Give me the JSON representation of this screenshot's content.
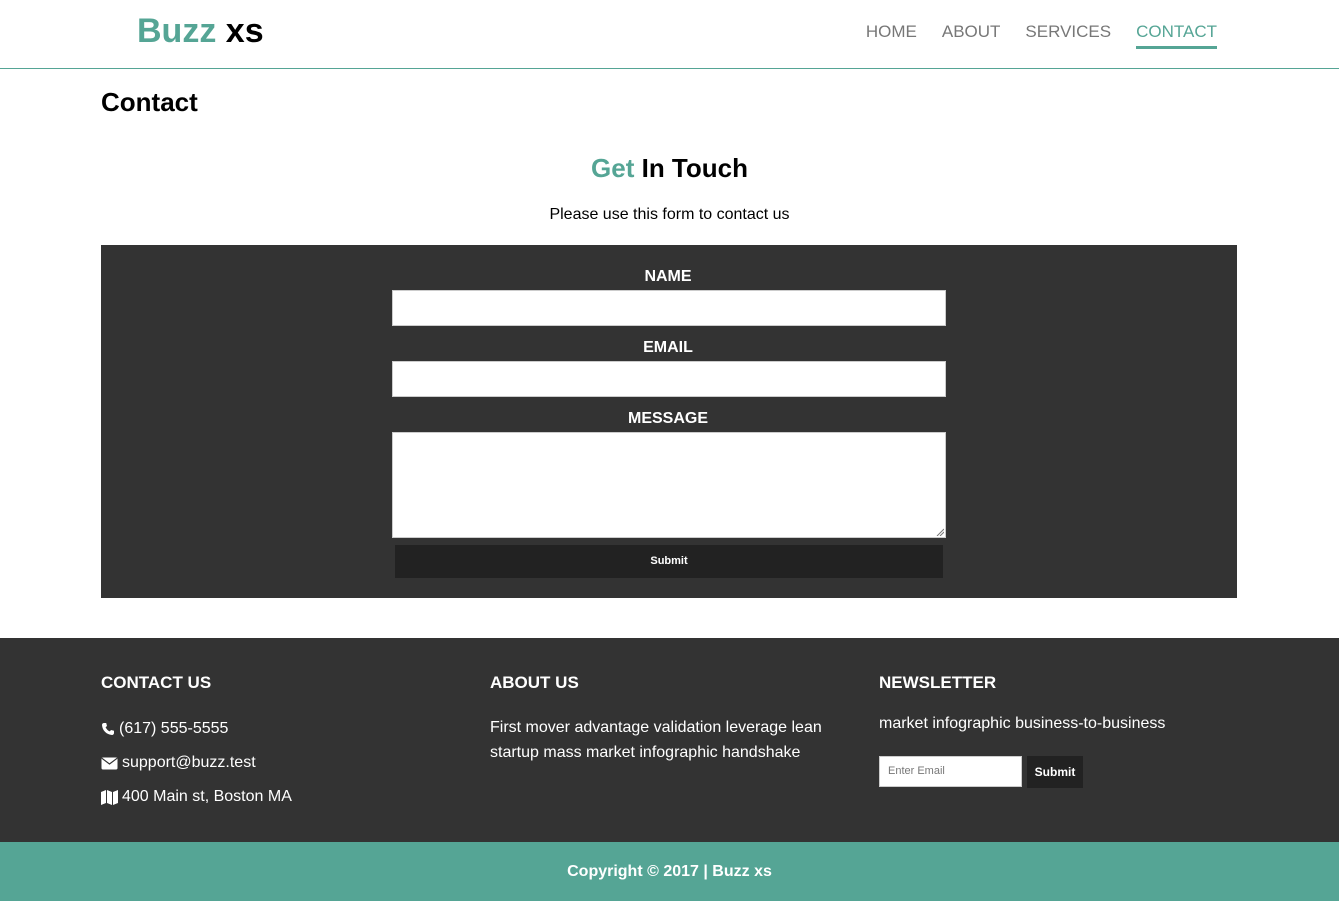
{
  "brand": {
    "logo_part1": "Buzz",
    "logo_part2": "xs",
    "accent_color": "#55a595",
    "dark_color": "#333333"
  },
  "nav": {
    "items": [
      {
        "label": "HOME",
        "active": false
      },
      {
        "label": "ABOUT",
        "active": false
      },
      {
        "label": "SERVICES",
        "active": false
      },
      {
        "label": "CONTACT",
        "active": true
      }
    ]
  },
  "page": {
    "title": "Contact",
    "heading_accent": "Get",
    "heading_rest": "In Touch",
    "subtitle": "Please use this form to contact us"
  },
  "form": {
    "name_label": "NAME",
    "name_value": "",
    "email_label": "EMAIL",
    "email_value": "",
    "message_label": "MESSAGE",
    "message_value": "",
    "submit_label": "Submit"
  },
  "footer": {
    "contact": {
      "heading": "CONTACT US",
      "phone": "(617) 555-5555",
      "email": "support@buzz.test",
      "address": "400 Main st, Boston MA",
      "phone_icon": "phone-icon",
      "email_icon": "envelope-icon",
      "address_icon": "map-icon"
    },
    "about": {
      "heading": "ABOUT US",
      "text": "First mover advantage validation leverage lean startup mass market infographic handshake"
    },
    "newsletter": {
      "heading": "NEWSLETTER",
      "text": "market infographic business-to-business",
      "input_placeholder": "Enter Email",
      "submit_label": "Submit"
    },
    "copyright": "Copyright © 2017 | Buzz xs"
  }
}
